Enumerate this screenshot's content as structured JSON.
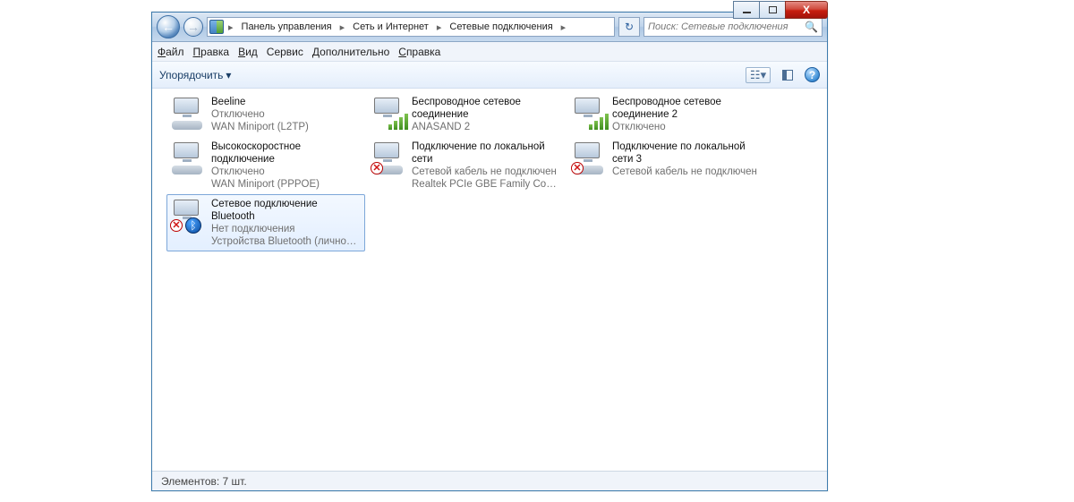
{
  "caption": {
    "close_glyph": "X"
  },
  "nav": {
    "back_glyph": "←",
    "fwd_glyph": "→",
    "crumbs": [
      "Панель управления",
      "Сеть и Интернет",
      "Сетевые подключения"
    ],
    "sep": "▸",
    "refresh_glyph": "↻"
  },
  "search": {
    "placeholder": "Поиск: Сетевые подключения",
    "icon": "🔍"
  },
  "menu": {
    "file": {
      "u": "Ф",
      "rest": "айл"
    },
    "edit": {
      "u": "П",
      "rest": "равка"
    },
    "view": {
      "u": "В",
      "rest": "ид"
    },
    "tools": {
      "plain": "Сервис"
    },
    "extra": {
      "u": "Д",
      "rest": "ополнительно"
    },
    "help": {
      "u": "С",
      "rest": "правка"
    }
  },
  "toolbar": {
    "organize": "Упорядочить",
    "dropdown_glyph": "▾",
    "view_glyph": "▾",
    "help_glyph": "?"
  },
  "connections": [
    {
      "name": "Beeline",
      "status": "Отключено",
      "device": "WAN Miniport (L2TP)",
      "type": "wired",
      "error": false,
      "selected": false
    },
    {
      "name": "Беспроводное сетевое соединение",
      "status": "ANASAND  2",
      "device": "",
      "type": "wifi",
      "error": false,
      "selected": false
    },
    {
      "name": "Беспроводное сетевое соединение 2",
      "status": "Отключено",
      "device": "",
      "type": "wifi",
      "error": false,
      "selected": false
    },
    {
      "name": "Высокоскоростное подключение",
      "status": "Отключено",
      "device": "WAN Miniport (PPPOE)",
      "type": "wired",
      "error": false,
      "selected": false
    },
    {
      "name": "Подключение по локальной сети",
      "status": "Сетевой кабель не подключен",
      "device": "Realtek PCIe GBE Family Controller",
      "type": "wired",
      "error": true,
      "selected": false
    },
    {
      "name": "Подключение по локальной сети 3",
      "status": "Сетевой кабель не подключен",
      "device": "",
      "type": "wired",
      "error": true,
      "selected": false
    },
    {
      "name": "Сетевое подключение Bluetooth",
      "status": "Нет подключения",
      "device": "Устройства Bluetooth (личной с...",
      "type": "bt",
      "error": true,
      "selected": true
    }
  ],
  "statusbar": {
    "text": "Элементов: 7 шт."
  }
}
